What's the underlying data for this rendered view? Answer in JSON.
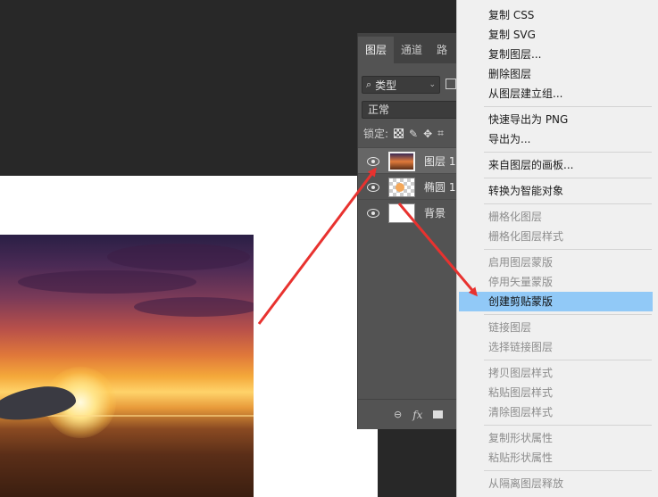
{
  "colors": {
    "workspace": "#282828",
    "panel": "#535353",
    "menu_bg": "#f0f0f0",
    "menu_highlight": "#91c9f7",
    "arrow": "#e8322f"
  },
  "layers_panel": {
    "tabs": [
      "图层",
      "通道",
      "路"
    ],
    "filter_label": "类型",
    "filter_icon": "search-icon",
    "blend_mode": "正常",
    "lock_label": "锁定:",
    "layers": [
      {
        "name": "图层 1",
        "thumb": "photo",
        "selected": true
      },
      {
        "name": "椭圆 1",
        "thumb": "shape",
        "selected": false
      },
      {
        "name": "背景",
        "thumb": "white",
        "selected": false
      }
    ],
    "bottom_fx": "fx"
  },
  "context_menu": {
    "items": [
      {
        "label": "复制 CSS",
        "enabled": true
      },
      {
        "label": "复制 SVG",
        "enabled": true
      },
      {
        "label": "复制图层...",
        "enabled": true
      },
      {
        "label": "删除图层",
        "enabled": true
      },
      {
        "label": "从图层建立组...",
        "enabled": true
      },
      {
        "label": "快速导出为 PNG",
        "enabled": true
      },
      {
        "label": "导出为...",
        "enabled": true
      },
      {
        "label": "来自图层的画板...",
        "enabled": true
      },
      {
        "label": "转换为智能对象",
        "enabled": true
      },
      {
        "label": "栅格化图层",
        "enabled": false
      },
      {
        "label": "栅格化图层样式",
        "enabled": false
      },
      {
        "label": "启用图层蒙版",
        "enabled": false
      },
      {
        "label": "停用矢量蒙版",
        "enabled": false
      },
      {
        "label": "创建剪贴蒙版",
        "enabled": true,
        "highlighted": true
      },
      {
        "label": "链接图层",
        "enabled": false
      },
      {
        "label": "选择链接图层",
        "enabled": false
      },
      {
        "label": "拷贝图层样式",
        "enabled": false
      },
      {
        "label": "粘贴图层样式",
        "enabled": false
      },
      {
        "label": "清除图层样式",
        "enabled": false
      },
      {
        "label": "复制形状属性",
        "enabled": false
      },
      {
        "label": "粘贴形状属性",
        "enabled": false
      },
      {
        "label": "从隔离图层释放",
        "enabled": false
      }
    ]
  }
}
